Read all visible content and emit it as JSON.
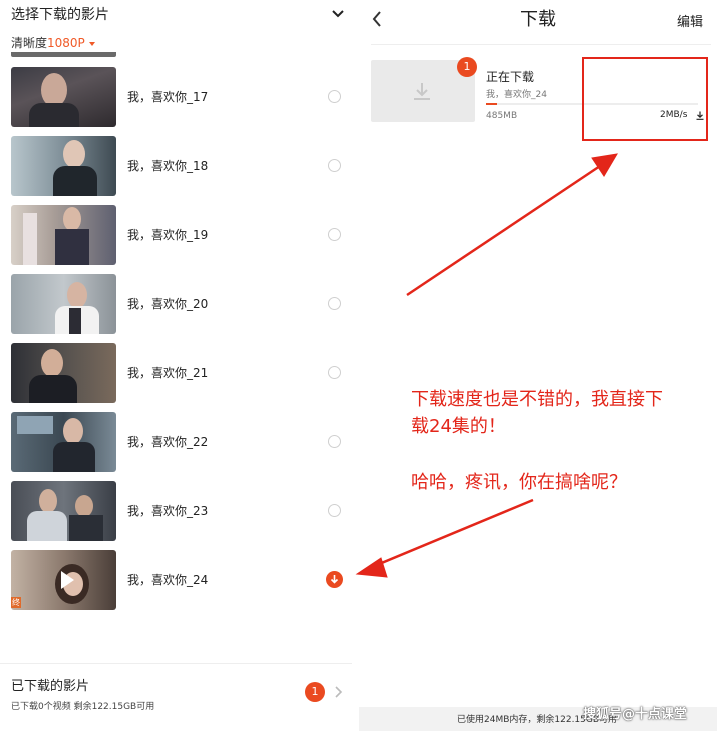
{
  "left_panel": {
    "title": "选择下载的影片",
    "quality_label": "清晰度",
    "quality_value": "1080P",
    "episodes": [
      {
        "label": "我，喜欢你_17",
        "state": "unselected"
      },
      {
        "label": "我，喜欢你_18",
        "state": "unselected"
      },
      {
        "label": "我，喜欢你_19",
        "state": "unselected"
      },
      {
        "label": "我，喜欢你_20",
        "state": "unselected"
      },
      {
        "label": "我，喜欢你_21",
        "state": "unselected"
      },
      {
        "label": "我，喜欢你_22",
        "state": "unselected"
      },
      {
        "label": "我，喜欢你_23",
        "state": "unselected"
      },
      {
        "label": "我，喜欢你_24",
        "state": "downloading"
      }
    ],
    "thumb_badge": "终",
    "footer": {
      "title": "已下载的影片",
      "subtitle": "已下载0个视频 剩余122.15GB可用",
      "badge_count": "1"
    }
  },
  "right_panel": {
    "title": "下载",
    "edit_label": "编辑",
    "download_item": {
      "badge_count": "1",
      "status": "正在下载",
      "name": "我，喜欢你_24",
      "size": "485MB",
      "speed": "2MB/s",
      "progress_fraction": 0.05
    },
    "storage_text": "已使用24MB内存，剩余122.15GB可用"
  },
  "annotation": {
    "line1": "下载速度也是不错的，我直接下",
    "line2": "载24集的！",
    "line3": "哈哈，疼讯，你在搞啥呢？",
    "color": "#e3261a"
  },
  "watermark": "搜狐号@十点课堂",
  "colors": {
    "accent": "#ea4a20",
    "annotation_red": "#e3261a"
  }
}
